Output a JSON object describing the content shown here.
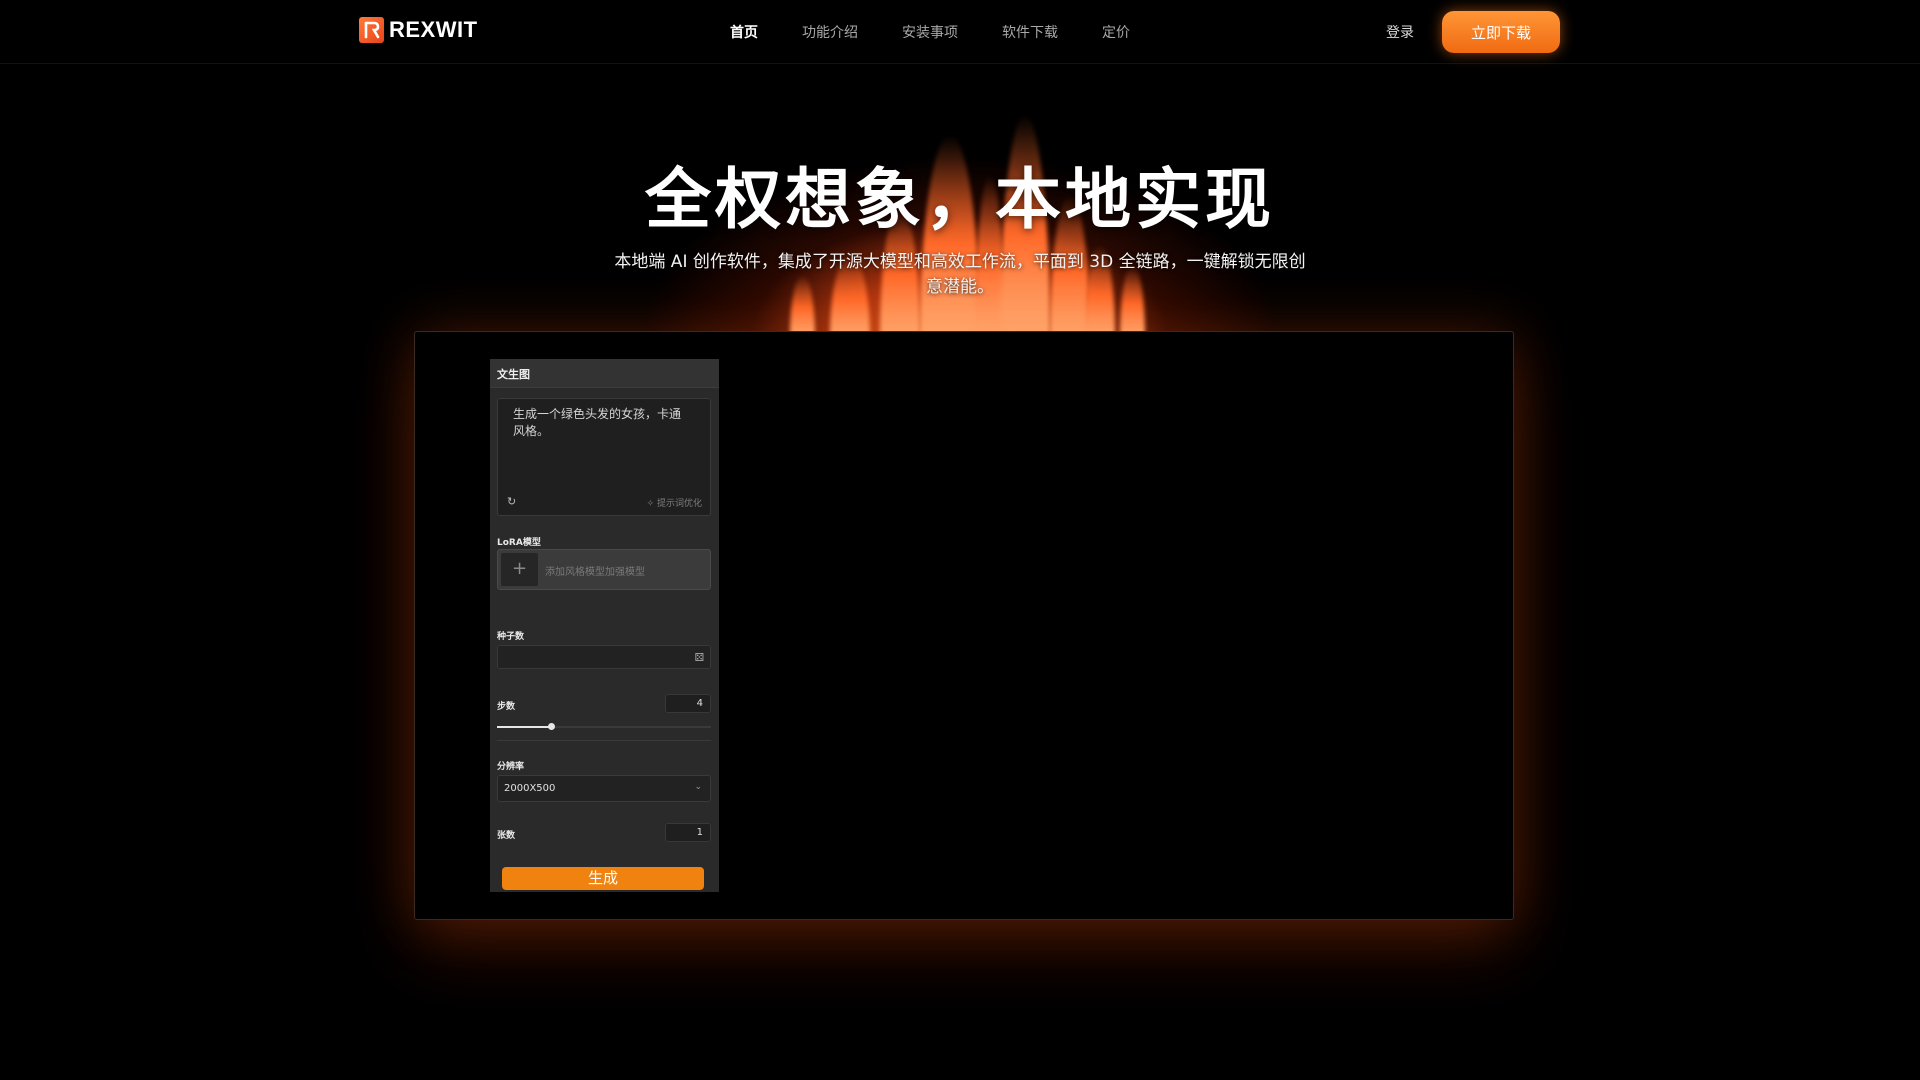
{
  "header": {
    "logo_text": "REXWIT",
    "nav": [
      {
        "label": "首页",
        "active": true
      },
      {
        "label": "功能介绍",
        "active": false
      },
      {
        "label": "安装事项",
        "active": false
      },
      {
        "label": "软件下载",
        "active": false
      },
      {
        "label": "定价",
        "active": false
      }
    ],
    "login_label": "登录",
    "download_label": "立即下载"
  },
  "hero": {
    "title": "全权想象，本地实现",
    "subtitle": "本地端 AI 创作软件，集成了开源大模型和高效工作流，平面到 3D 全链路，一键解锁无限创意潜能。"
  },
  "app_panel": {
    "header": "文生图",
    "prompt_text": "生成一个绿色头发的女孩，卡通风格。",
    "optimize_label": "提示词优化",
    "lora_label": "LoRA模型",
    "lora_hint": "添加风格模型加强模型",
    "seed_label": "种子数",
    "steps_label": "步数",
    "steps_value": "4",
    "steps_fraction": 0.25,
    "resolution_label": "分辨率",
    "resolution_value": "2000X500",
    "count_label": "张数",
    "count_value": "1",
    "generate_label": "生成"
  },
  "colors": {
    "accent": "#f07a18",
    "background": "#000000"
  }
}
